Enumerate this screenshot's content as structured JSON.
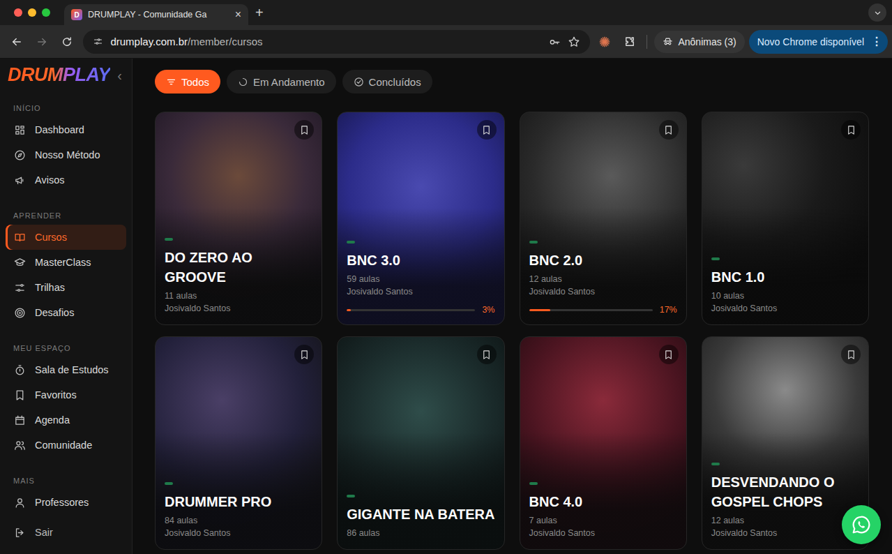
{
  "browser": {
    "tab": {
      "favicon": "D",
      "title": "DRUMPLAY - Comunidade Ga",
      "close": "×"
    },
    "new_tab": "+",
    "url": {
      "host": "drumplay.com.br",
      "path": "/member/cursos"
    },
    "profile": "Anônimas (3)",
    "update": {
      "label": "Novo Chrome disponível",
      "menu": "⋮"
    }
  },
  "sidebar": {
    "logo": "DRUMPLAY",
    "collapse": "‹",
    "sections": [
      {
        "title": "INÍCIO",
        "items": [
          {
            "label": "Dashboard",
            "selected": false
          },
          {
            "label": "Nosso Método",
            "selected": false
          },
          {
            "label": "Avisos",
            "selected": false
          }
        ]
      },
      {
        "title": "APRENDER",
        "items": [
          {
            "label": "Cursos",
            "selected": true
          },
          {
            "label": "MasterClass",
            "selected": false
          },
          {
            "label": "Trilhas",
            "selected": false
          },
          {
            "label": "Desafios",
            "selected": false
          }
        ]
      },
      {
        "title": "MEU ESPAÇO",
        "items": [
          {
            "label": "Sala de Estudos",
            "selected": false
          },
          {
            "label": "Favoritos",
            "selected": false
          },
          {
            "label": "Agenda",
            "selected": false
          },
          {
            "label": "Comunidade",
            "selected": false
          }
        ]
      },
      {
        "title": "MAIS",
        "items": [
          {
            "label": "Professores",
            "selected": false
          }
        ]
      }
    ],
    "logout": "Sair"
  },
  "filters": [
    {
      "label": "Todos",
      "selected": true
    },
    {
      "label": "Em Andamento",
      "selected": false
    },
    {
      "label": "Concluídos",
      "selected": false
    }
  ],
  "courses": [
    {
      "title": "DO ZERO AO GROOVE",
      "lessons": "11 aulas",
      "author": "Josivaldo Santos",
      "bookmarked": false
    },
    {
      "title": "BNC 3.0",
      "lessons": "59 aulas",
      "author": "Josivaldo Santos",
      "bookmarked": false,
      "progress": {
        "level": 0.03,
        "label": "3%"
      }
    },
    {
      "title": "BNC 2.0",
      "lessons": "12 aulas",
      "author": "Josivaldo Santos",
      "bookmarked": false,
      "progress": {
        "level": 0.17,
        "label": "17%"
      }
    },
    {
      "title": "BNC 1.0",
      "lessons": "10 aulas",
      "author": "Josivaldo Santos",
      "bookmarked": false
    },
    {
      "title": "DRUMMER PRO",
      "lessons": "84 aulas",
      "author": "Josivaldo Santos",
      "bookmarked": false
    },
    {
      "title": "GIGANTE NA BATERA",
      "lessons": "86 aulas",
      "bookmarked": false
    },
    {
      "title": "BNC 4.0",
      "lessons": "7 aulas",
      "author": "Josivaldo Santos",
      "bookmarked": false
    },
    {
      "title": "DESVENDANDO O GOSPEL CHOPS",
      "lessons": "12 aulas",
      "author": "Josivaldo Santos",
      "bookmarked": false
    }
  ]
}
